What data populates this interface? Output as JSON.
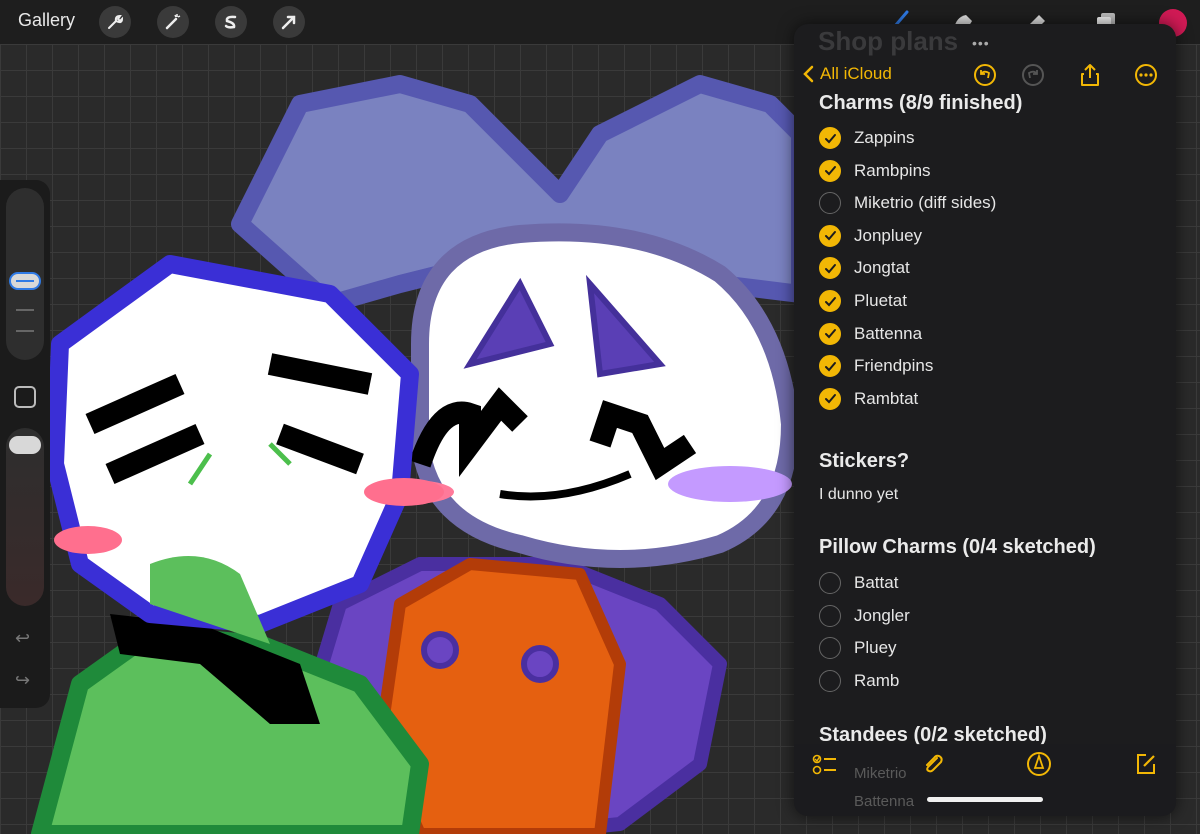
{
  "procreate": {
    "gallery_label": "Gallery",
    "tools_left": [
      "wrench-icon",
      "magic-wand-icon",
      "adjust-s-icon",
      "select-arrow-icon"
    ],
    "tools_right": [
      "brush-icon",
      "smudge-icon",
      "eraser-icon",
      "layers-icon"
    ],
    "active_color": "#d11a55"
  },
  "notes": {
    "ghost_title": "Shop plans",
    "back_label": "All iCloud",
    "accent": "#f2b705",
    "sections": {
      "charms": {
        "heading": "Charms (8/9 finished)",
        "items": [
          {
            "label": "Zappins",
            "done": true
          },
          {
            "label": "Rambpins",
            "done": true
          },
          {
            "label": "Miketrio (diff sides)",
            "done": false
          },
          {
            "label": "Jonpluey",
            "done": true
          },
          {
            "label": "Jongtat",
            "done": true
          },
          {
            "label": "Pluetat",
            "done": true
          },
          {
            "label": "Battenna",
            "done": true
          },
          {
            "label": "Friendpins",
            "done": true
          },
          {
            "label": "Rambtat",
            "done": true
          }
        ]
      },
      "stickers": {
        "heading": "Stickers?",
        "text": "I dunno yet"
      },
      "pillow": {
        "heading": "Pillow Charms (0/4 sketched)",
        "items": [
          {
            "label": "Battat",
            "done": false
          },
          {
            "label": "Jongler",
            "done": false
          },
          {
            "label": "Pluey",
            "done": false
          },
          {
            "label": "Ramb",
            "done": false
          }
        ]
      },
      "standees": {
        "heading": "Standees (0/2 sketched)",
        "faded_items": [
          "Miketrio",
          "Battenna"
        ]
      }
    }
  }
}
